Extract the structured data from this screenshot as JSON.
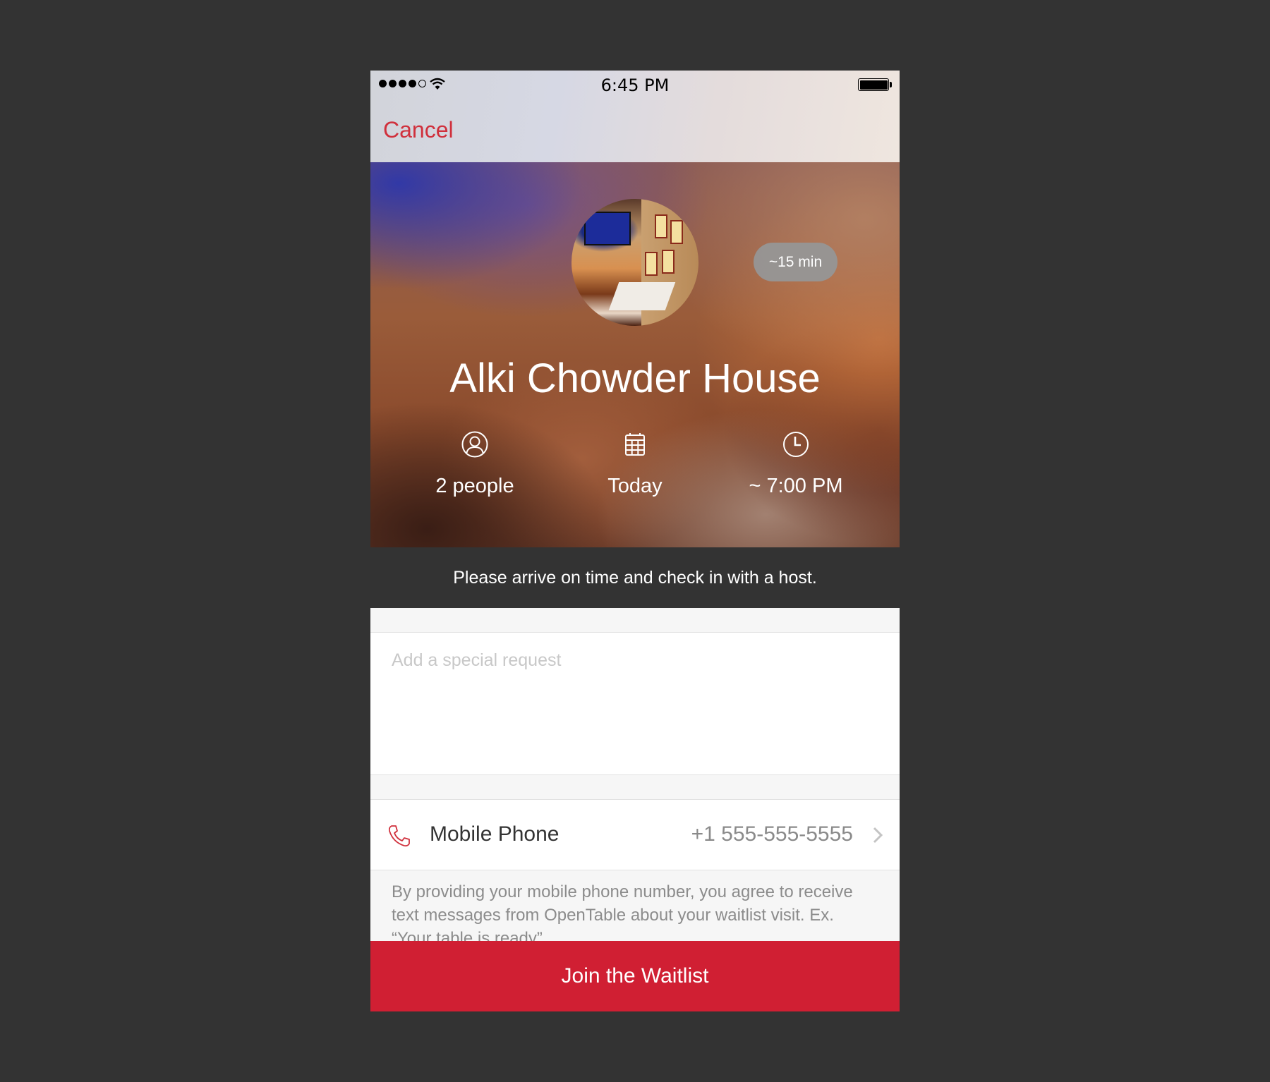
{
  "status_bar": {
    "time": "6:45 PM",
    "signal_bars_filled": 4,
    "signal_bars_total": 5,
    "battery_level": 1.0,
    "icons": [
      "signal-dots-icon",
      "wifi-icon",
      "battery-icon"
    ]
  },
  "nav": {
    "cancel_label": "Cancel"
  },
  "restaurant": {
    "name": "Alki Chowder House",
    "wait_badge": "~15 min",
    "photo_alt": "restaurant-photo"
  },
  "details": [
    {
      "icon": "person-icon",
      "label": "2 people"
    },
    {
      "icon": "calendar-icon",
      "label": "Today"
    },
    {
      "icon": "clock-icon",
      "label": "~ 7:00 PM"
    }
  ],
  "notice": "Please arrive on time and check in with a host.",
  "special_request": {
    "value": "",
    "placeholder": "Add a special request"
  },
  "phone_row": {
    "icon": "phone-icon",
    "label": "Mobile Phone",
    "value": "+1 555-555-5555"
  },
  "disclaimer": "By providing your mobile phone number, you agree to receive text messages from OpenTable about your waitlist visit. Ex. “Your table is ready”",
  "primary_button": {
    "label": "Join the Waitlist"
  },
  "colors": {
    "accent": "#d01f33",
    "cancel_text": "#d0303c",
    "background": "#333333",
    "notice_bar": "#333333",
    "badge": "#969696"
  }
}
